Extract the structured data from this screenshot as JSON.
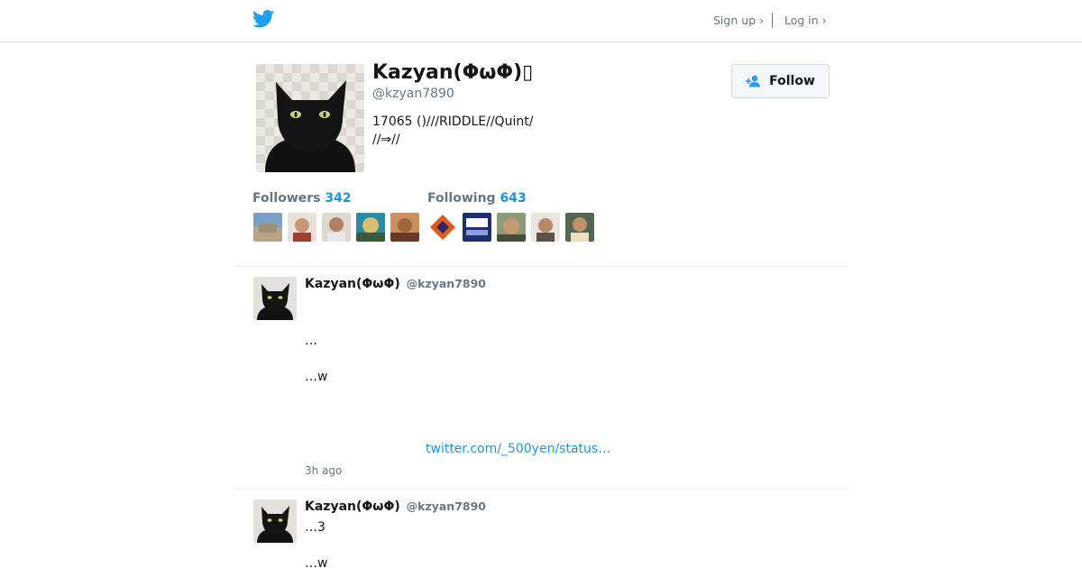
{
  "header": {
    "logo_icon": "twitter-bird-icon",
    "brand_color": "#1da1f2",
    "signup_label": "Sign up ›",
    "login_label": "Log in ›"
  },
  "profile": {
    "name": "Kazyan(ΦωΦ)▯",
    "handle": "@kzyan7890",
    "bio_line1": "17065  ()///RIDDLE//Quint/",
    "bio_line2": "//⇒//",
    "follow_label": "Follow",
    "follow_icon": "add-user-icon"
  },
  "stats": {
    "followers_label": "Followers",
    "followers_count": "342",
    "following_label": "Following",
    "following_count": "643"
  },
  "tweets": [
    {
      "name": "Kazyan(ΦωΦ)",
      "handle": "@kzyan7890",
      "line1": "…",
      "line2": "…w",
      "link": "twitter.com/_500yen/status…",
      "time": "3h ago"
    },
    {
      "name": "Kazyan(ΦωΦ)",
      "handle": "@kzyan7890",
      "line1": "…3",
      "line2": "…w"
    }
  ],
  "colors": {
    "accent": "#1b95e0",
    "muted": "#657786",
    "border": "#e6ecf0"
  }
}
